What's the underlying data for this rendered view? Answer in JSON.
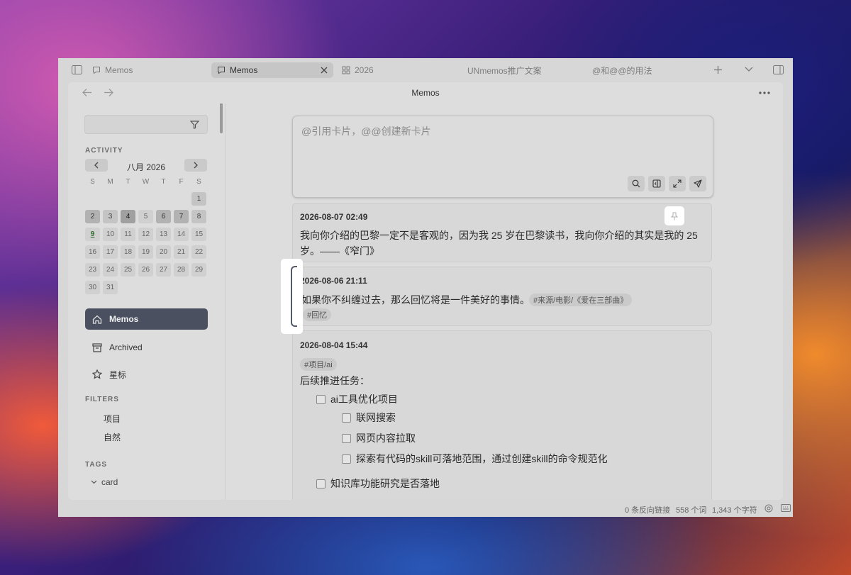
{
  "tabbar": {
    "tabs": [
      {
        "label": "Memos"
      },
      {
        "label": "Memos"
      },
      {
        "label": "2026"
      },
      {
        "label": "UNmemos推广文案"
      },
      {
        "label": "@和@@的用法"
      }
    ]
  },
  "navbar": {
    "title": "Memos"
  },
  "sidebar": {
    "search": {
      "value": "",
      "placeholder": ""
    },
    "activity_label": "ACTIVITY",
    "calendar": {
      "month_label": "八月 2026",
      "weekdays": [
        "S",
        "M",
        "T",
        "W",
        "T",
        "F",
        "S"
      ],
      "days": [
        "1",
        "2",
        "3",
        "4",
        "5",
        "6",
        "7",
        "8",
        "9",
        "10",
        "11",
        "12",
        "13",
        "14",
        "15",
        "16",
        "17",
        "18",
        "19",
        "20",
        "21",
        "22",
        "23",
        "24",
        "25",
        "26",
        "27",
        "28",
        "29",
        "30",
        "31"
      ]
    },
    "nav": [
      {
        "label": "Memos",
        "icon": "home-icon"
      },
      {
        "label": "Archived",
        "icon": "archive-icon"
      },
      {
        "label": "星标",
        "icon": "star-icon"
      }
    ],
    "filters_label": "FILTERS",
    "filters": [
      "项目",
      "自然"
    ],
    "tags_label": "TAGS",
    "tags": [
      {
        "label": "card"
      }
    ]
  },
  "editor": {
    "placeholder": "@引用卡片，@@创建新卡片",
    "tools": [
      "search-icon",
      "sidebar-panel-icon",
      "expand-icon",
      "send-icon"
    ]
  },
  "memos": [
    {
      "date": "2026-08-07 02:49",
      "text": "我向你介绍的巴黎一定不是客观的，因为我 25 岁在巴黎读书，我向你介绍的其实是我的 25 岁。——《窄门》",
      "text_line1": "我向你介绍的巴黎一定不是客观的，因为我 25 岁在巴黎读书，我向你介绍的其实是我的 25",
      "text_line2": "岁。——《窄门》"
    },
    {
      "date": "2026-08-06 21:11",
      "text": "如果你不纠缠过去，那么回忆将是一件美好的事情。",
      "tags": [
        "#来源/电影/《爱在三部曲》",
        "#回忆"
      ]
    },
    {
      "date": "2026-08-04 15:44",
      "tags": [
        "#项目/ai"
      ],
      "heading": "后续推进任务：",
      "todos": [
        {
          "label": "ai工具优化项目",
          "level": 0,
          "done": false
        },
        {
          "label": "联网搜索",
          "level": 1,
          "done": false
        },
        {
          "label": "网页内容拉取",
          "level": 1,
          "done": false
        },
        {
          "label": "探索有代码的skill可落地范围，通过创建skill的命令规范化",
          "level": 1,
          "done": false
        },
        {
          "label": "知识库功能研究是否落地",
          "level": 0,
          "done": false
        }
      ]
    }
  ],
  "statusbar": {
    "backlinks": "0 条反向链接",
    "words": "558 个词",
    "chars": "1,343 个字符"
  },
  "colors": {
    "active_nav": "#4a5060",
    "today": "#2e6b2e"
  }
}
